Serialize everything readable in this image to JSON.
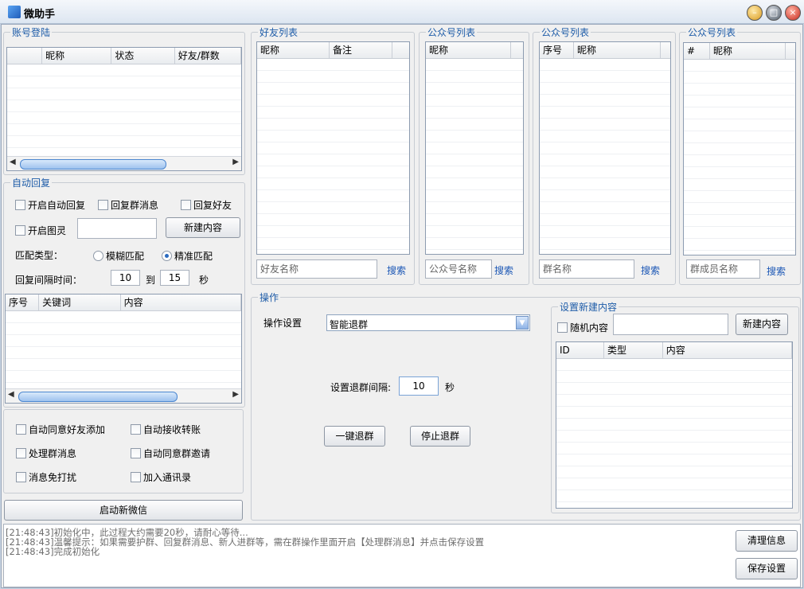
{
  "window": {
    "title": "微助手"
  },
  "account": {
    "title": "账号登陆",
    "columns": [
      "",
      "昵称",
      "状态",
      "好友/群数"
    ]
  },
  "friends": {
    "title": "好友列表",
    "columns": [
      "昵称",
      "备注"
    ],
    "search_placeholder": "好友名称",
    "search_label": "搜索"
  },
  "public1": {
    "title": "公众号列表",
    "columns": [
      "昵称"
    ],
    "search_placeholder": "公众号名称",
    "search_label": "搜索"
  },
  "public2": {
    "title": "公众号列表",
    "columns": [
      "序号",
      "昵称"
    ],
    "search_placeholder": "群名称",
    "search_label": "搜索"
  },
  "public3": {
    "title": "公众号列表",
    "columns": [
      "#",
      "昵称"
    ],
    "search_placeholder": "群成员名称",
    "search_label": "搜索"
  },
  "auto_reply": {
    "title": "自动回复",
    "auto_reply": "开启自动回复",
    "reply_group": "回复群消息",
    "reply_friend": "回复好友",
    "tuling": "开启图灵",
    "tuling_value": "",
    "new_content": "新建内容",
    "match_type_label": "匹配类型：",
    "fuzzy": "模糊匹配",
    "exact": "精准匹配",
    "interval_label": "回复间隔时间：",
    "interval_from": "10",
    "to_label": "到",
    "interval_to": "15",
    "sec_label": "秒",
    "columns": [
      "序号",
      "关键词",
      "内容"
    ]
  },
  "options": {
    "auto_accept_friend": "自动同意好友添加",
    "auto_receive_transfer": "自动接收转账",
    "handle_group_msg": "处理群消息",
    "auto_accept_group_invite": "自动同意群邀请",
    "mute": "消息免打扰",
    "add_contacts": "加入通讯录",
    "start_wechat": "启动新微信"
  },
  "operation": {
    "title": "操作",
    "setting_label": "操作设置",
    "setting_value": "智能退群",
    "interval_label": "设置退群间隔:",
    "interval_value": "10",
    "sec_label": "秒",
    "quit_all": "一键退群",
    "stop_quit": "停止退群"
  },
  "new_content": {
    "title": "设置新建内容",
    "random": "随机内容",
    "random_value": "",
    "new_button": "新建内容",
    "columns": [
      "ID",
      "类型",
      "内容"
    ]
  },
  "log": {
    "lines": [
      "[21:48:43]初始化中，此过程大约需要20秒，请耐心等待...",
      "[21:48:43]温馨提示：如果需要护群、回复群消息、新人进群等，需在群操作里面开启【处理群消息】并点击保存设置",
      "[21:48:43]完成初始化"
    ],
    "clear": "清理信息",
    "save": "保存设置"
  }
}
